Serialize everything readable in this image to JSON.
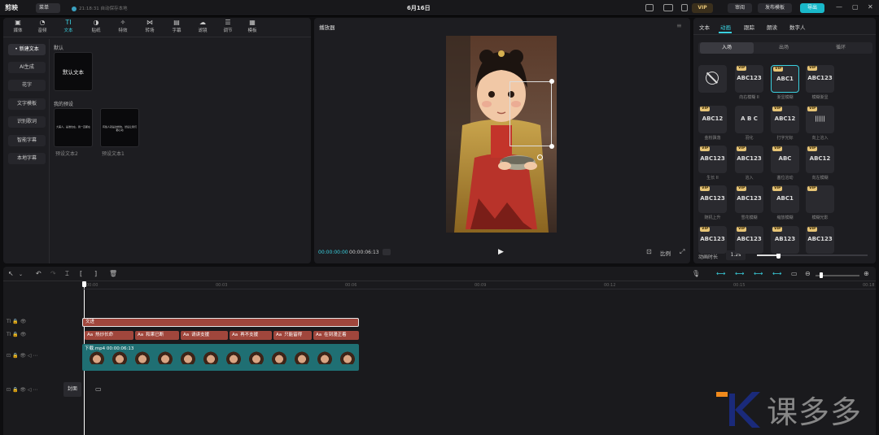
{
  "app": {
    "logo": "剪映",
    "menu": "菜单",
    "autosave": "21:18:31 自动保存本地",
    "title": "6月16日",
    "vip_badge": "VIP",
    "review": "审阅",
    "publish_template": "发布模板",
    "export": "导出"
  },
  "toolbar_tabs": [
    {
      "label": "媒体",
      "icon": "media-icon"
    },
    {
      "label": "音频",
      "icon": "audio-icon"
    },
    {
      "label": "文本",
      "icon": "text-icon"
    },
    {
      "label": "贴纸",
      "icon": "sticker-icon"
    },
    {
      "label": "特效",
      "icon": "effects-icon"
    },
    {
      "label": "转场",
      "icon": "transition-icon"
    },
    {
      "label": "字幕",
      "icon": "caption-icon"
    },
    {
      "label": "滤镜",
      "icon": "filter-icon"
    },
    {
      "label": "调节",
      "icon": "adjust-icon"
    },
    {
      "label": "模板",
      "icon": "template-icon"
    }
  ],
  "side_menu": [
    "• 新建文本",
    "AI生成",
    "花字",
    "文字模板",
    "识别歌词",
    "智能字幕",
    "本地字幕"
  ],
  "text_panel": {
    "default_label": "默认",
    "default_thumb": "默认文本",
    "presets_label": "我的预设",
    "presets": [
      {
        "thumb": "大美人，是谁也在，我一直都在",
        "caption": "预设文本2"
      },
      {
        "thumb": "有些人就是这样的，然后让我们都心动",
        "caption": "预设文本1"
      }
    ]
  },
  "player": {
    "title": "播放器",
    "current_time": "00:00:00:00",
    "total_time": "00:00:06:13",
    "ratio_label": "比例"
  },
  "right_panel": {
    "tabs": [
      "文本",
      "动画",
      "跟踪",
      "朗读",
      "数字人"
    ],
    "active_tab": "动画",
    "segments": [
      "入场",
      "出场",
      "循环"
    ],
    "active_segment": "入场",
    "cards": [
      {
        "text": "",
        "caption": "",
        "vip": false,
        "none": true
      },
      {
        "text": "ABC123",
        "caption": "向右模糊 II",
        "vip": true
      },
      {
        "text": "ABC1",
        "caption": "渐显模糊",
        "vip": true,
        "selected": true
      },
      {
        "text": "ABC123",
        "caption": "模糊渐显",
        "vip": true
      },
      {
        "text": "ABC12",
        "caption": "金粉飘落",
        "vip": true
      },
      {
        "text": "A B C",
        "caption": "羽化",
        "vip": false
      },
      {
        "text": "ABC12",
        "caption": "打字光标",
        "vip": true
      },
      {
        "text": "|||||",
        "caption": "向上溶入",
        "vip": true
      },
      {
        "text": "ABC123",
        "caption": "生长 II",
        "vip": true
      },
      {
        "text": "ABC123",
        "caption": "溶入",
        "vip": true
      },
      {
        "text": "ABC",
        "caption": "塞位溶动",
        "vip": true
      },
      {
        "text": "ABC12",
        "caption": "向左模糊",
        "vip": true
      },
      {
        "text": "ABC123",
        "caption": "随机上升",
        "vip": true
      },
      {
        "text": "ABC123",
        "caption": "雪花模糊",
        "vip": true
      },
      {
        "text": "ABC1",
        "caption": "缩放模糊",
        "vip": true
      },
      {
        "text": "",
        "caption": "模糊光影",
        "vip": true
      },
      {
        "text": "ABC123",
        "caption": "",
        "vip": true
      },
      {
        "text": "ABC123",
        "caption": "",
        "vip": true
      },
      {
        "text": "AB123",
        "caption": "",
        "vip": true
      },
      {
        "text": "ABC123",
        "caption": "",
        "vip": true
      }
    ],
    "duration_label": "动画时长",
    "duration_value": "1.2s",
    "duration_fraction": 0.19
  },
  "timeline": {
    "ruler": [
      "00:00",
      "00:03",
      "00:06",
      "00:09",
      "00:12",
      "00:15",
      "00:18"
    ],
    "text_clip": "文进",
    "subtitles": [
      "热炒长命",
      "和果已断",
      "请讲支援",
      "再不支援",
      "只能留得",
      "在到漫正着"
    ],
    "subtitle_prefix": "Aa",
    "video_clip": "下载.mp4  00:00:06:13",
    "cover_label": "封面"
  },
  "watermark": "课多多",
  "colors": {
    "accent": "#3ad0df",
    "clip_text": "#a0463c",
    "clip_video": "#1f6f73",
    "export": "#19b8c9"
  }
}
